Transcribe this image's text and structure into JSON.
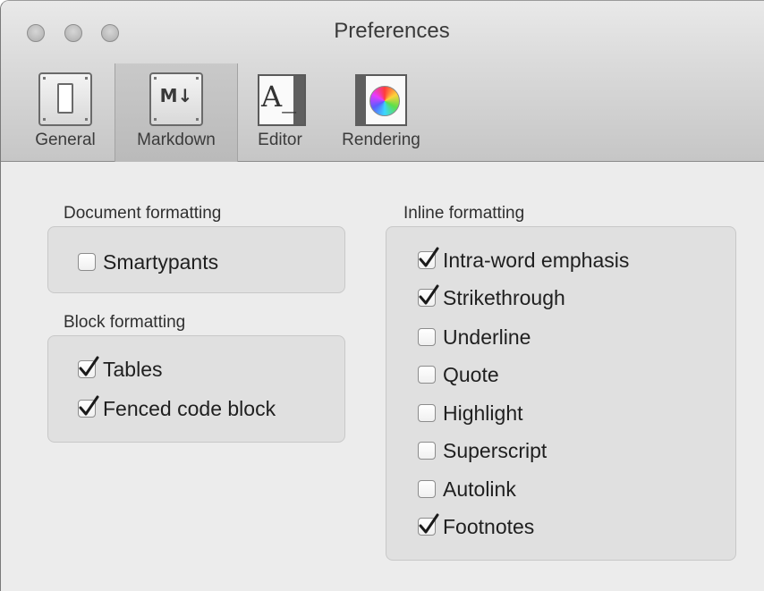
{
  "window": {
    "title": "Preferences"
  },
  "toolbar": {
    "items": [
      {
        "label": "General",
        "icon": "switch-icon"
      },
      {
        "label": "Markdown",
        "icon": "markdown-icon",
        "icon_text": "M↓"
      },
      {
        "label": "Editor",
        "icon": "editor-font-icon",
        "icon_text": "A_"
      },
      {
        "label": "Rendering",
        "icon": "color-wheel-icon"
      }
    ],
    "selected": "Markdown"
  },
  "document_formatting": {
    "title": "Document formatting",
    "options": [
      {
        "label": "Smartypants",
        "checked": false
      }
    ]
  },
  "block_formatting": {
    "title": "Block formatting",
    "options": [
      {
        "label": "Tables",
        "checked": true
      },
      {
        "label": "Fenced code block",
        "checked": true
      }
    ]
  },
  "inline_formatting": {
    "title": "Inline formatting",
    "options": [
      {
        "label": "Intra-word emphasis",
        "checked": true
      },
      {
        "label": "Strikethrough",
        "checked": true
      },
      {
        "label": "Underline",
        "checked": false
      },
      {
        "label": "Quote",
        "checked": false
      },
      {
        "label": "Highlight",
        "checked": false
      },
      {
        "label": "Superscript",
        "checked": false
      },
      {
        "label": "Autolink",
        "checked": false
      },
      {
        "label": "Footnotes",
        "checked": true
      }
    ]
  }
}
